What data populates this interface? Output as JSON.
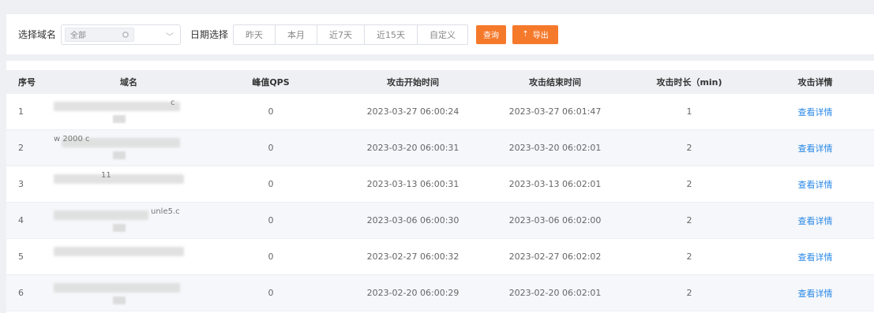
{
  "filters": {
    "domain_label": "选择域名",
    "domain_chip": "全部",
    "date_label": "日期选择",
    "date_options": [
      "昨天",
      "本月",
      "近7天",
      "近15天",
      "自定义"
    ],
    "query_label": "查询",
    "export_label": "导出"
  },
  "table": {
    "headers": [
      "序号",
      "域名",
      "峰值QPS",
      "攻击开始时间",
      "攻击结束时间",
      "攻击时长（min)",
      "攻击详情"
    ],
    "rows": [
      {
        "index": "1",
        "domain_fragment": "c",
        "qps": "0",
        "start": "2023-03-27 06:00:24",
        "end": "2023-03-27 06:01:47",
        "duration": "1",
        "detail": "查看详情"
      },
      {
        "index": "2",
        "domain_fragment": "w  2000  c",
        "qps": "0",
        "start": "2023-03-20 06:00:31",
        "end": "2023-03-20 06:02:01",
        "duration": "2",
        "detail": "查看详情"
      },
      {
        "index": "3",
        "domain_fragment": "11",
        "qps": "0",
        "start": "2023-03-13 06:00:31",
        "end": "2023-03-13 06:02:01",
        "duration": "2",
        "detail": "查看详情"
      },
      {
        "index": "4",
        "domain_fragment": "unle5.c",
        "qps": "0",
        "start": "2023-03-06 06:00:30",
        "end": "2023-03-06 06:02:00",
        "duration": "2",
        "detail": "查看详情"
      },
      {
        "index": "5",
        "domain_fragment": "",
        "qps": "0",
        "start": "2023-02-27 06:00:32",
        "end": "2023-02-27 06:02:02",
        "duration": "2",
        "detail": "查看详情"
      },
      {
        "index": "6",
        "domain_fragment": "",
        "qps": "0",
        "start": "2023-02-20 06:00:29",
        "end": "2023-02-20 06:02:01",
        "duration": "2",
        "detail": "查看详情"
      }
    ]
  },
  "colors": {
    "accent": "#f5792b",
    "link": "#2a88e8"
  }
}
